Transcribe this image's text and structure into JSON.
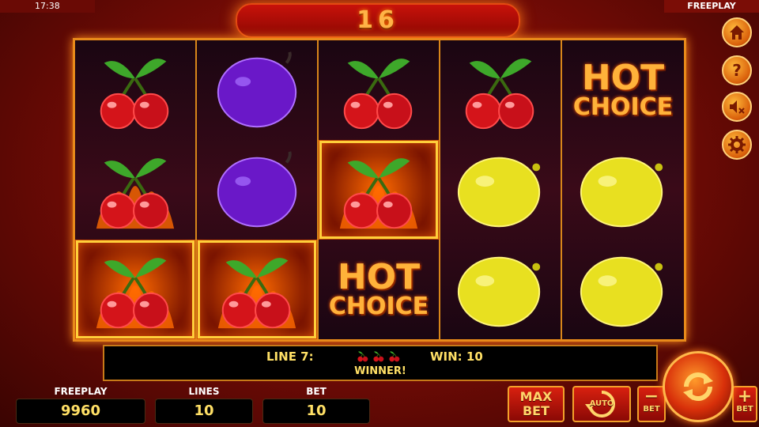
{
  "status": {
    "time": "17:38",
    "mode": "FREEPLAY"
  },
  "top_win": "16",
  "reels": [
    [
      "cherry",
      "cherry-fire",
      "cherry-fire-win"
    ],
    [
      "plum",
      "plum",
      "cherry-fire-win"
    ],
    [
      "cherry",
      "cherry-fire-win",
      "hot-choice"
    ],
    [
      "cherry",
      "lemon",
      "lemon"
    ],
    [
      "hot-choice",
      "lemon",
      "lemon"
    ]
  ],
  "hot_choice": {
    "line1": "HOT",
    "line2": "CHOICE"
  },
  "message": {
    "line": "LINE 7:",
    "win": "WIN: 10",
    "status": "WINNER!"
  },
  "stats": {
    "freeplay_label": "FREEPLAY",
    "freeplay_value": "9960",
    "lines_label": "LINES",
    "lines_value": "10",
    "bet_label": "BET",
    "bet_value": "10"
  },
  "buttons": {
    "max_bet_1": "MAX",
    "max_bet_2": "BET",
    "auto": "AUTO",
    "bet_minus_sign": "−",
    "bet_minus_label": "BET",
    "bet_plus_sign": "+",
    "bet_plus_label": "BET"
  },
  "side_icons": [
    "home-icon",
    "help-icon",
    "sound-off-icon",
    "settings-icon"
  ],
  "colors": {
    "accent": "#ffb23a",
    "frame": "#e88a1a",
    "background": "#8d0703",
    "text_yellow": "#ffe066"
  }
}
